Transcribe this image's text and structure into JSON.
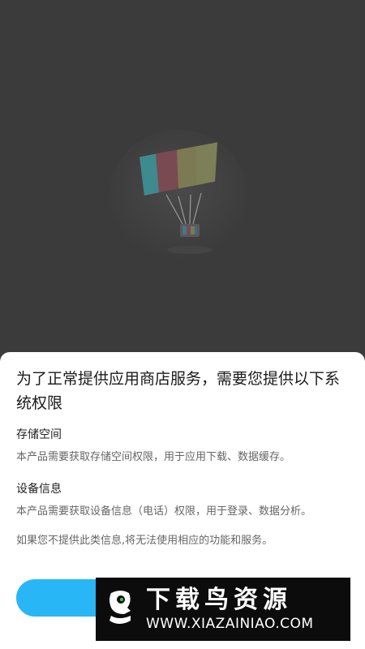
{
  "dialog": {
    "title": "为了正常提供应用商店服务，需要您提供以下系统权限",
    "sections": [
      {
        "heading": "存储空间",
        "body": "本产品需要获取存储空间权限，用于应用下载、数据缓存。"
      },
      {
        "heading": "设备信息",
        "body": "本产品需要获取设备信息（电话）权限，用于登录、数据分析。"
      }
    ],
    "footer_note": "如果您不提供此类信息,将无法使用相应的功能和服务。",
    "confirm_label": ""
  },
  "watermark": {
    "name": "下载鸟资源",
    "url": "WWW.XIAZAINIAO.COM"
  },
  "colors": {
    "background": "#3b3b3b",
    "sheet": "#ffffff",
    "accent": "#29b6f6"
  },
  "icons": {
    "illustration": "parachute-tv-illustration",
    "watermark_logo": "bird-logo-icon"
  }
}
